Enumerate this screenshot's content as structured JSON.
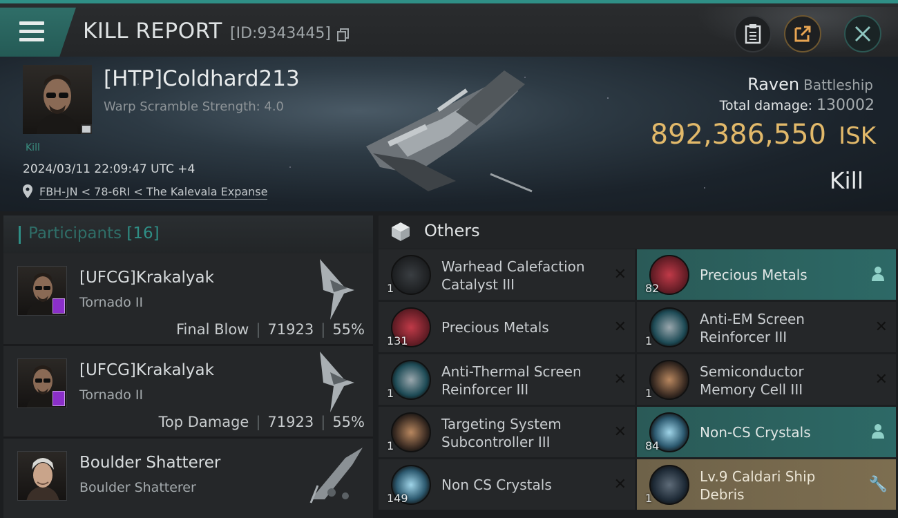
{
  "header": {
    "title": "KILL REPORT",
    "kill_id": "[ID:9343445]",
    "menu_icon": "hamburger-menu-icon",
    "buttons": [
      "clipboard-icon",
      "share-icon",
      "close-icon"
    ]
  },
  "victim": {
    "name": "[HTP]Coldhard213",
    "warp_scramble": "Warp Scramble Strength: 4.0",
    "tag": "Kill",
    "datetime": "2024/03/11 22:09:47 UTC +4",
    "location": "FBH-JN < 78-6RI < The Kalevala Expanse",
    "ship": "Raven",
    "ship_class": "Battleship",
    "total_damage_label": "Total damage:",
    "total_damage": "130002",
    "isk_value": "892,386,550",
    "isk_unit": "ISK",
    "result": "Kill"
  },
  "participants": {
    "label": "Participants",
    "count": "[16]",
    "rows": [
      {
        "name": "[UFCG]Krakalyak",
        "ship": "Tornado II",
        "role": "Final Blow",
        "damage": "71923",
        "percent": "55%"
      },
      {
        "name": "[UFCG]Krakalyak",
        "ship": "Tornado II",
        "role": "Top Damage",
        "damage": "71923",
        "percent": "55%"
      },
      {
        "name": "Boulder Shatterer",
        "ship": "Boulder Shatterer"
      }
    ]
  },
  "others": {
    "title": "Others",
    "left": [
      {
        "qty": "1",
        "name": "Warhead Calefaction Catalyst III"
      },
      {
        "qty": "131",
        "name": "Precious Metals"
      },
      {
        "qty": "1",
        "name": "Anti-Thermal Screen Reinforcer III"
      },
      {
        "qty": "1",
        "name": "Targeting System Subcontroller III"
      },
      {
        "qty": "149",
        "name": "Non  CS Crystals"
      }
    ],
    "right": [
      {
        "qty": "82",
        "name": "Precious Metals",
        "state": "dropped"
      },
      {
        "qty": "1",
        "name": "Anti-EM Screen Reinforcer III",
        "state": "destroyed"
      },
      {
        "qty": "1",
        "name": "Semiconductor Memory Cell III",
        "state": "destroyed"
      },
      {
        "qty": "84",
        "name": "Non-CS Crystals",
        "state": "dropped"
      },
      {
        "qty": "1",
        "name": "Lv.9 Caldari Ship Debris",
        "state": "loot"
      }
    ]
  },
  "colors": {
    "accent": "#2f8f86",
    "isk": "#e2b96a",
    "dropped": "#2d6966",
    "loot": "#7d6e50"
  }
}
